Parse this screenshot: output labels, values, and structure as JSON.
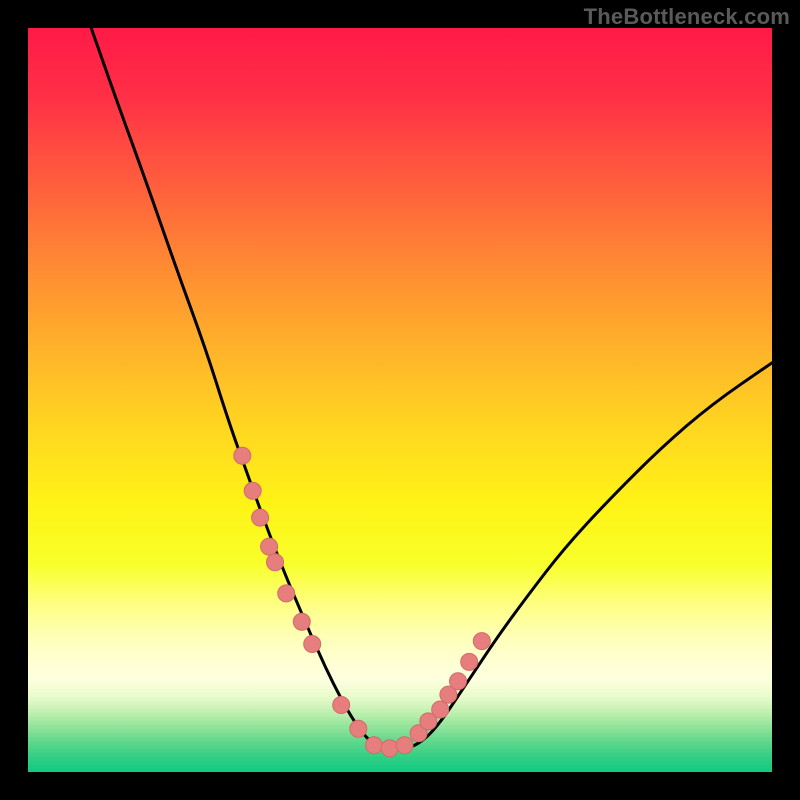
{
  "watermark": "TheBottleneck.com",
  "colors": {
    "frame": "#000000",
    "curve": "#000000",
    "marker_fill": "#e77e7e",
    "marker_stroke": "#d36a6a",
    "gradient_top": "#ff1a47",
    "gradient_bottom": "#0fca82"
  },
  "chart_data": {
    "type": "line",
    "title": "",
    "xlabel": "",
    "ylabel": "",
    "xlim": [
      0,
      100
    ],
    "ylim": [
      0,
      100
    ],
    "grid": false,
    "legend": false,
    "note": "Axes unlabeled; values are percent of plot width/height read from pixel positions. y=0 at bottom (green), y=100 at top (red). Curve is a V / well shape with minimum near x≈47, flat at y≈3.",
    "series": [
      {
        "name": "bottleneck-curve",
        "x": [
          8.5,
          12,
          16,
          20,
          24,
          27,
          29.5,
          31.5,
          33.2,
          35,
          36.5,
          38,
          40,
          42,
          44,
          46,
          48,
          50,
          52,
          54,
          56,
          58,
          60,
          63,
          67,
          72,
          78,
          85,
          92,
          100
        ],
        "y": [
          100,
          90,
          79,
          67.5,
          56.5,
          47,
          40,
          34.5,
          30,
          25.5,
          22,
          18.5,
          14,
          10,
          6.5,
          4,
          3,
          3,
          3.5,
          5,
          7.5,
          10.5,
          13.5,
          18,
          23.5,
          30,
          36.5,
          43.5,
          49.5,
          55
        ]
      }
    ],
    "markers": {
      "name": "highlighted-points",
      "note": "Pink scatter dots along lower portion of curve.",
      "x": [
        28.8,
        30.2,
        31.2,
        32.4,
        33.2,
        34.7,
        36.8,
        38.2,
        42.1,
        44.4,
        46.5,
        48.6,
        50.6,
        52.5,
        53.8,
        55.4,
        56.5,
        57.8,
        59.3,
        61.0
      ],
      "y": [
        42.5,
        37.8,
        34.2,
        30.3,
        28.2,
        24.0,
        20.2,
        17.2,
        9.0,
        5.8,
        3.6,
        3.2,
        3.6,
        5.2,
        6.8,
        8.4,
        10.4,
        12.2,
        14.8,
        17.6
      ]
    }
  }
}
